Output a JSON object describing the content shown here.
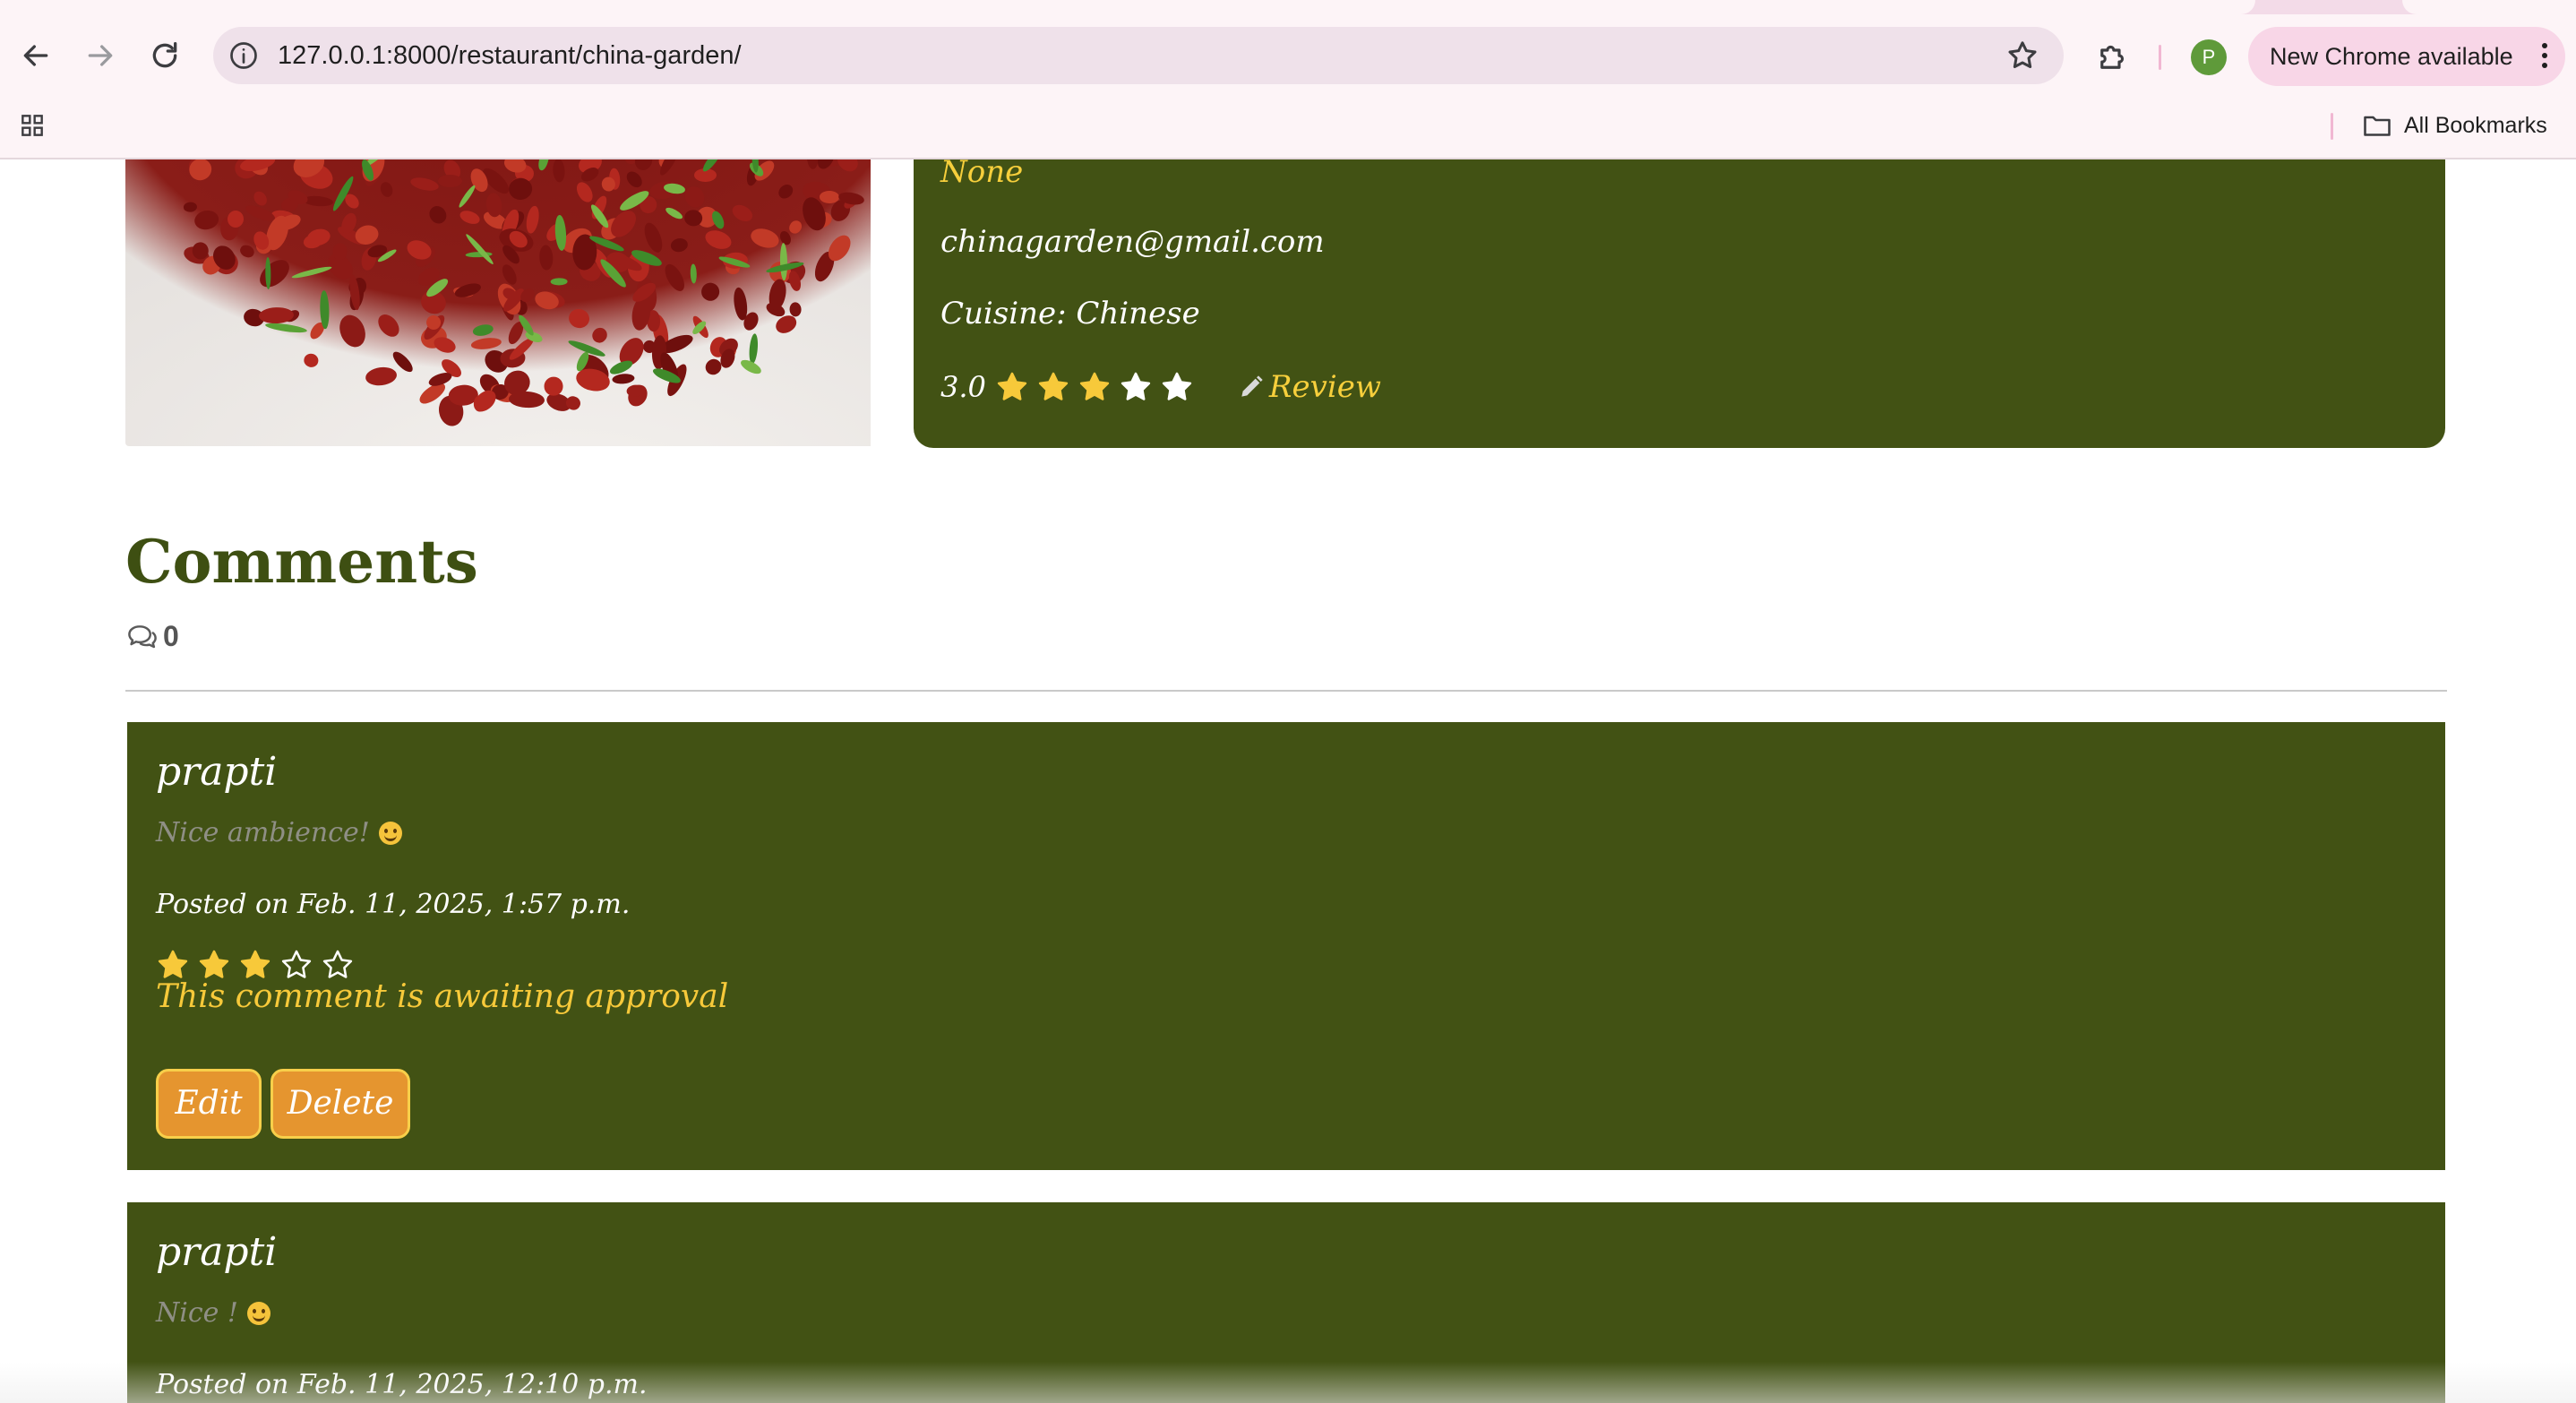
{
  "browser": {
    "url": "127.0.0.1:8000/restaurant/china-garden/",
    "profile_initial": "P",
    "update_label": "New Chrome available",
    "all_bookmarks_label": "All Bookmarks",
    "icons": [
      "back-icon",
      "forward-icon",
      "reload-icon",
      "site-info-icon",
      "bookmark-star-icon",
      "extensions-icon",
      "more-icon",
      "apps-grid-icon",
      "folder-icon"
    ]
  },
  "restaurant": {
    "field_none": "None",
    "email": "chinagarden@gmail.com",
    "cuisine": "Cuisine: Chinese",
    "rating": "3.0",
    "rating_stars": 5,
    "review_label": "Review"
  },
  "comments": {
    "title": "Comments",
    "count": "0",
    "items": [
      {
        "user": "prapti",
        "body": "Nice ambience!",
        "posted": "Posted on Feb. 11, 2025, 1:57 p.m.",
        "stars": 3,
        "stars_max": 5,
        "status": "This comment is awaiting approval",
        "edit_label": "Edit",
        "delete_label": "Delete"
      },
      {
        "user": "prapti",
        "body": "Nice !",
        "posted": "Posted on Feb. 11, 2025, 12:10 p.m."
      }
    ]
  },
  "colors": {
    "card_green": "#425214",
    "accent_yellow": "#f7cf3c",
    "button_orange": "#e5952f",
    "heading_green": "#3e4f12"
  }
}
